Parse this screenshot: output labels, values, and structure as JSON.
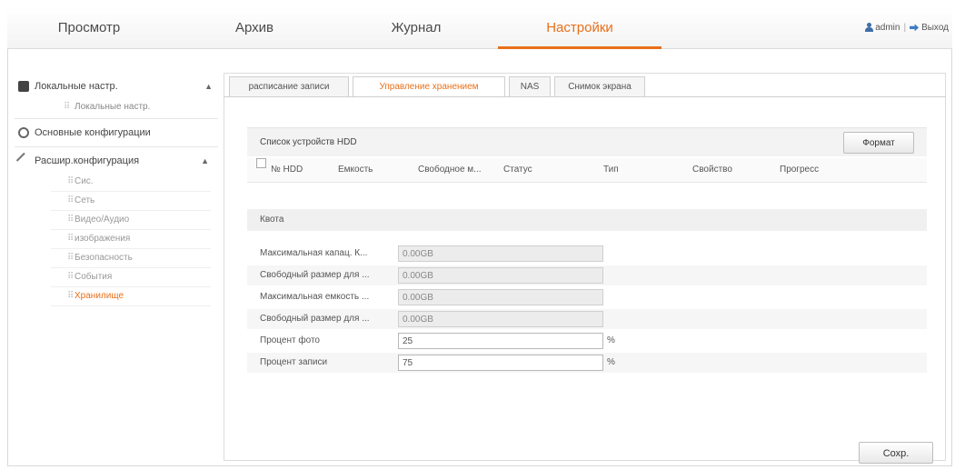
{
  "nav": {
    "items": [
      "Просмотр",
      "Архив",
      "Журнал",
      "Настройки"
    ],
    "active_index": 3,
    "user": "admin",
    "separator": "|",
    "logout": "Выход"
  },
  "sidebar": {
    "local": {
      "label": "Локальные настр.",
      "sub": "Локальные настр."
    },
    "basic": {
      "label": "Основные конфигурации"
    },
    "advanced": {
      "label": "Расшир.конфигурация",
      "items": [
        "Сис.",
        "Сеть",
        "Видео/Аудио",
        "изображения",
        "Безопасность",
        "События",
        "Хранилище"
      ],
      "active_index": 6
    }
  },
  "tabs": [
    "расписание записи",
    "Управление хранением",
    "NAS",
    "Снимок экрана"
  ],
  "active_tab": 1,
  "hdd": {
    "title": "Список устройств HDD",
    "format_button": "Формат",
    "columns": [
      "№ HDD",
      "Емкость",
      "Свободное м...",
      "Статус",
      "Тип",
      "Свойство",
      "Прогресс"
    ]
  },
  "quota": {
    "header": "Квота",
    "rows": [
      {
        "label": "Максимальная капац. К...",
        "value": "0.00GB",
        "readonly": true
      },
      {
        "label": "Свободный размер для ...",
        "value": "0.00GB",
        "readonly": true
      },
      {
        "label": "Максимальная емкость ...",
        "value": "0.00GB",
        "readonly": true
      },
      {
        "label": "Свободный размер для ...",
        "value": "0.00GB",
        "readonly": true
      },
      {
        "label": "Процент фото",
        "value": "25",
        "readonly": false,
        "unit": "%"
      },
      {
        "label": "Процент записи",
        "value": "75",
        "readonly": false,
        "unit": "%"
      }
    ]
  },
  "save_button": "Сохр.",
  "colors": {
    "accent": "#e8701a",
    "icon_blue": "#3d6ea8"
  }
}
